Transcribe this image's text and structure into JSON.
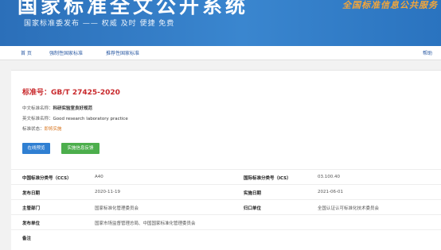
{
  "banner": {
    "title": "国家标准全文公开系统",
    "subtitle": "国家标准委发布 —— 权威 及时 便捷 免费",
    "logo_text": "全国标准信息公共服务"
  },
  "nav": {
    "items": [
      {
        "label": "首 页"
      },
      {
        "label": "强制性国家标准"
      },
      {
        "label": "推荐性国家标准"
      }
    ],
    "help": "帮助"
  },
  "standard": {
    "number_label": "标准号：",
    "number": "GB/T 27425-2020",
    "cn_name_label": "中文标准名称：",
    "cn_name": "科研实验室良好规范",
    "en_name_label": "英文标准名称：",
    "en_name": "Good research laboratory practice",
    "status_label": "标准状态：",
    "status": "即将实施"
  },
  "buttons": {
    "preview": "在线预览",
    "feedback": "实施信息反馈"
  },
  "colors": {
    "banner": "#3a86cf",
    "accent_red": "#c8282b",
    "status_orange": "#d8751f",
    "button_blue": "#2f7fd2",
    "button_green": "#4cae4c"
  },
  "table": {
    "ccs_label": "中国标准分类号（CCS）",
    "ccs": "A40",
    "ics_label": "国际标准分类号（ICS）",
    "ics": "03.100.40",
    "publish_label": "发布日期",
    "publish": "2020-11-19",
    "implement_label": "实施日期",
    "implement": "2021-06-01",
    "dept_label": "主管部门",
    "dept": "国家标准化管理委员会",
    "central_label": "归口单位",
    "central": "全国认证认可标准化技术委员会",
    "issuer_label": "发布单位",
    "issuer": "国家市场监督管理总局、中国国家标准化管理委员会",
    "remark_label": "备注"
  }
}
